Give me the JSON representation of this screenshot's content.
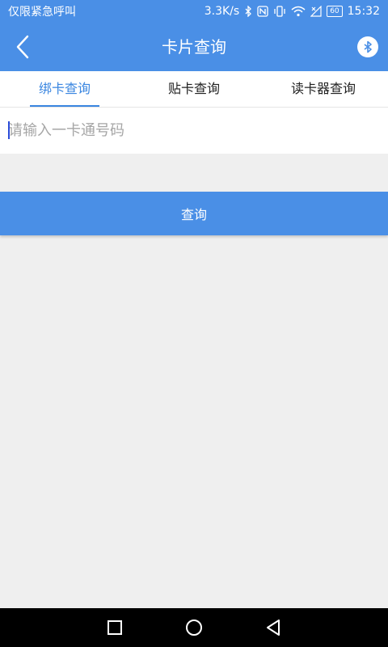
{
  "status_bar": {
    "left_text": "仅限紧急呼叫",
    "net_speed": "3.3K/s",
    "battery": "60",
    "time": "15:32",
    "icons": [
      "bluetooth-icon",
      "nfc-icon",
      "vibrate-icon",
      "wifi-icon",
      "no-signal-icon",
      "battery-icon"
    ]
  },
  "header": {
    "title": "卡片查询",
    "back_icon": "back-icon",
    "right_icon": "bluetooth-icon"
  },
  "tabs": [
    {
      "label": "绑卡查询",
      "active": true
    },
    {
      "label": "贴卡查询",
      "active": false
    },
    {
      "label": "读卡器查询",
      "active": false
    }
  ],
  "card_input": {
    "placeholder": "请输入一卡通号码",
    "value": ""
  },
  "query_button": {
    "label": "查询"
  },
  "colors": {
    "primary": "#4a8fe6",
    "tab_active": "#3a86e0",
    "background": "#efefef"
  },
  "nav": {
    "icons": [
      "recent-apps-icon",
      "home-icon",
      "back-nav-icon"
    ]
  }
}
